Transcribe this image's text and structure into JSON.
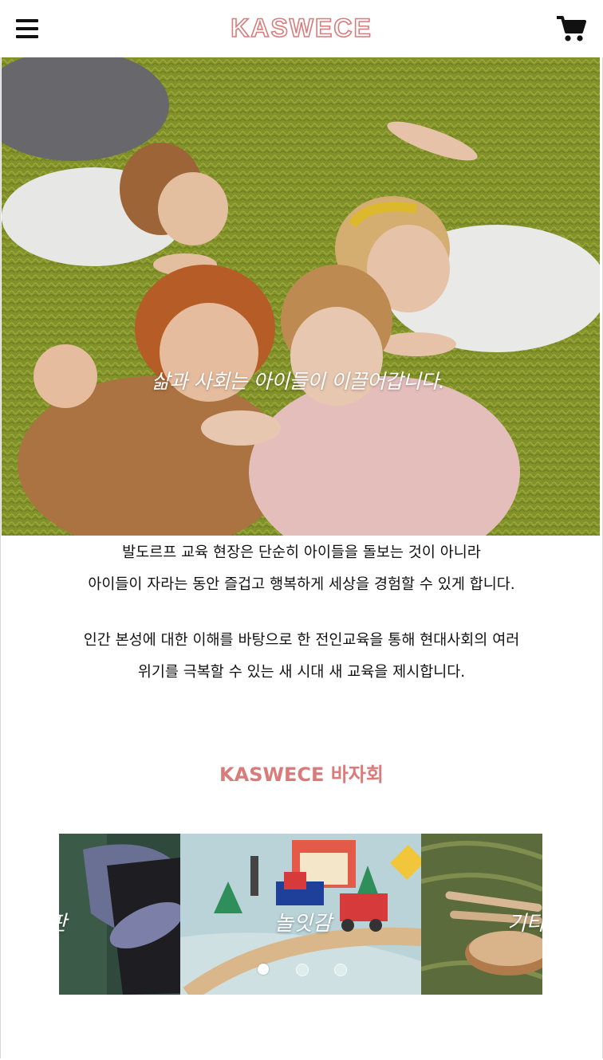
{
  "header": {
    "logo": "KASWECE",
    "menu_icon": "hamburger-menu-icon",
    "cart_icon": "shopping-cart-icon"
  },
  "hero": {
    "caption": "삶과 사회는 아이들이 이끌어갑니다."
  },
  "intro": {
    "line1": "발도르프 교육 현장은 단순히 아이들을 돌보는 것이 아니라",
    "line2": "아이들이 자라는 동안 즐겁고 행복하게 세상을 경험할 수 있게 합니다.",
    "line3": "인간 본성에 대한 이해를 바탕으로 한 전인교육을 통해 현대사회의 여러",
    "line4": "위기를 극복할 수 있는 새 시대 새 교육을 제시합니다."
  },
  "bazaar": {
    "title": "KASWECE 바자회",
    "slides": [
      {
        "label": "판"
      },
      {
        "label": "놀잇감"
      },
      {
        "label": "기타"
      }
    ],
    "active_index": 0,
    "dot_count": 3
  },
  "colors": {
    "brand": "#d97b7b",
    "text": "#111111"
  }
}
